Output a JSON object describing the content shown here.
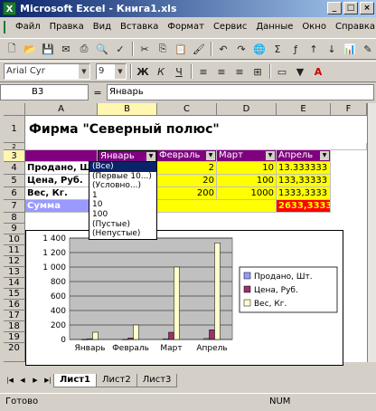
{
  "window": {
    "title": "Microsoft Excel - Книга1.xls"
  },
  "menu": [
    "Файл",
    "Правка",
    "Вид",
    "Вставка",
    "Формат",
    "Сервис",
    "Данные",
    "Окно",
    "Справка"
  ],
  "format_toolbar": {
    "font_name": "Arial Cyr",
    "font_size": "9"
  },
  "formula_bar": {
    "cell_ref": "B3",
    "eq": "=",
    "content": "Январь"
  },
  "columns": [
    "A",
    "B",
    "C",
    "D",
    "E",
    "F"
  ],
  "rows": [
    "1",
    "2",
    "3",
    "4",
    "5",
    "6",
    "7",
    "8",
    "9",
    "10",
    "11",
    "12",
    "13",
    "14",
    "15",
    "16",
    "17",
    "18",
    "19",
    "20"
  ],
  "cells": {
    "title": "Фирма \"Северный полюс\"",
    "headers": [
      "Январь",
      "Февраль",
      "Март",
      "Апрель"
    ],
    "r4": [
      "Продано, Шт.",
      "",
      "2",
      "10",
      "13.333333"
    ],
    "r5": [
      "Цена, Руб.",
      "",
      "20",
      "100",
      "133,33333"
    ],
    "r6": [
      "Вес, Кг.",
      "",
      "200",
      "1000",
      "1333,3333"
    ],
    "r7": [
      "Сумма",
      "",
      "",
      "",
      "2633,3333"
    ]
  },
  "filter_dropdown": [
    "(Все)",
    "(Первые 10...)",
    "(Условно...)",
    "1",
    "10",
    "100",
    "(Пустые)",
    "(Непустые)"
  ],
  "sheets": [
    "Лист1",
    "Лист2",
    "Лист3"
  ],
  "status": {
    "ready": "Готово",
    "num": "NUM"
  },
  "chart_data": {
    "type": "bar",
    "categories": [
      "Январь",
      "Февраль",
      "Март",
      "Апрель"
    ],
    "series": [
      {
        "name": "Продано, Шт.",
        "values": [
          1,
          2,
          10,
          13.33
        ],
        "color": "#9999ff"
      },
      {
        "name": "Цена, Руб.",
        "values": [
          10,
          20,
          100,
          133.33
        ],
        "color": "#993366"
      },
      {
        "name": "Вес, Кг.",
        "values": [
          100,
          200,
          1000,
          1333.33
        ],
        "color": "#ffffcc"
      }
    ],
    "ylim": [
      0,
      1400
    ],
    "yticks": [
      "0",
      "200",
      "400",
      "600",
      "800",
      "1 000",
      "1 200",
      "1 400"
    ],
    "plot_background": "#c0c0c0",
    "legend_position": "right"
  }
}
